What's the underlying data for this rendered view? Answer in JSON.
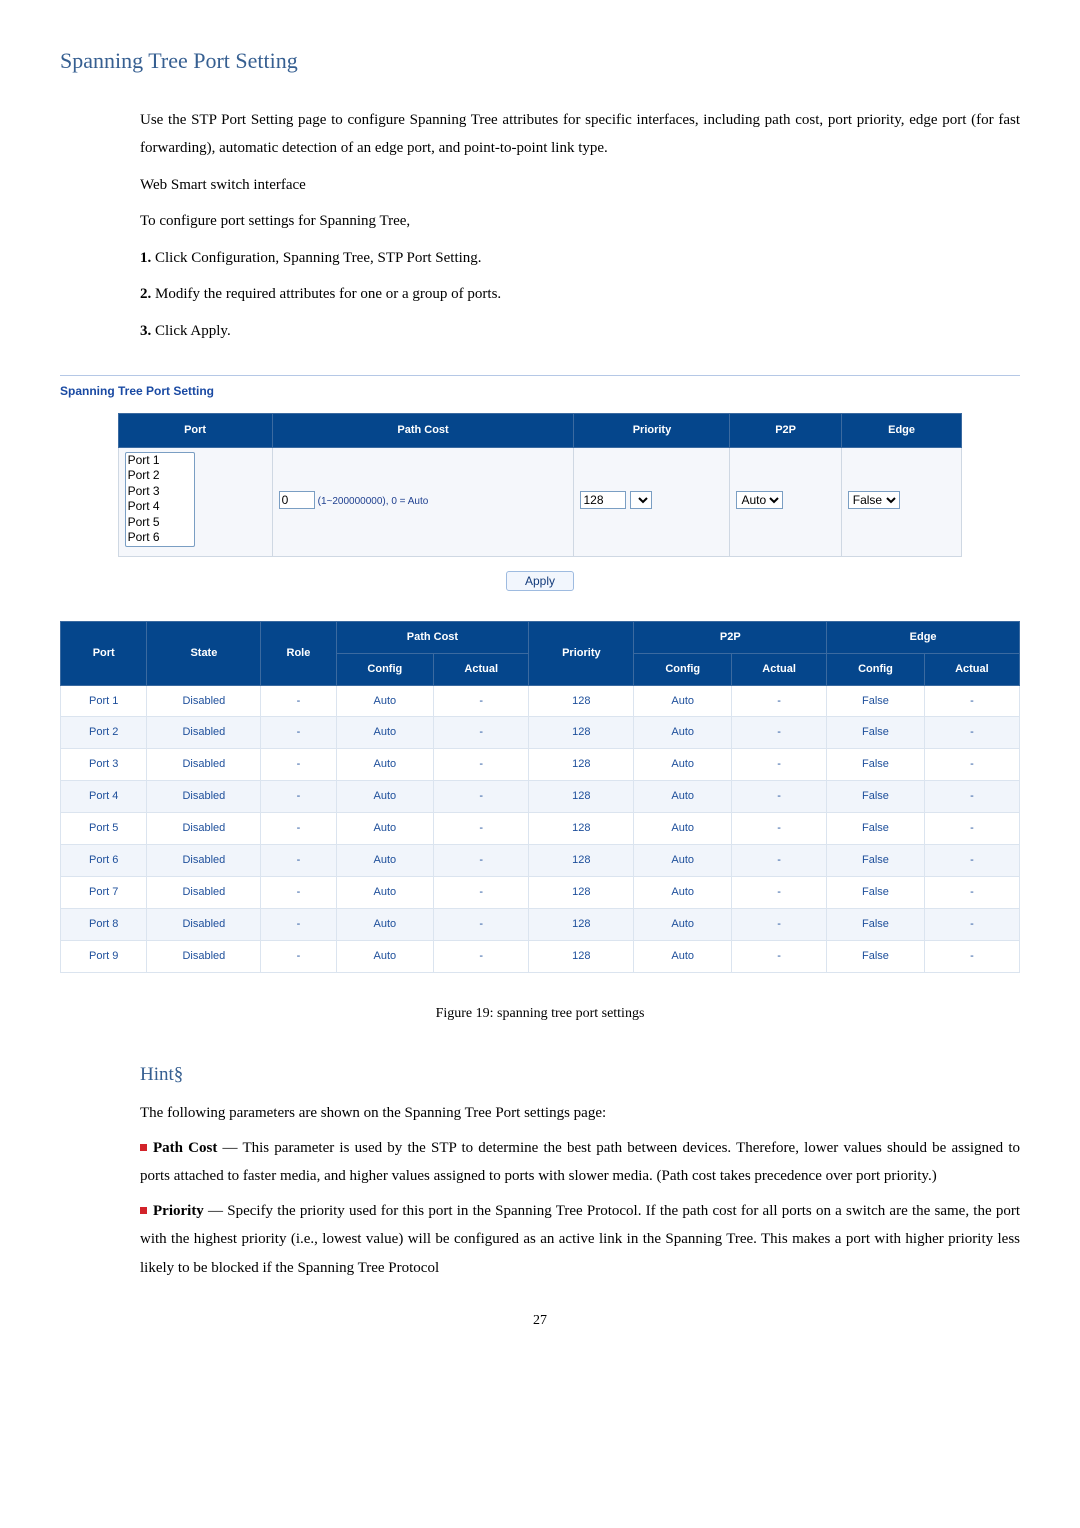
{
  "heading": "Spanning Tree Port Setting",
  "intro": "Use the STP Port Setting page to configure Spanning Tree attributes for specific interfaces, including path cost, port priority, edge port (for fast forwarding), automatic detection of an edge port, and point-to-point link type.",
  "subhead": "Web Smart switch interface",
  "configure_line": "To configure port settings for Spanning Tree,",
  "steps": [
    {
      "num": "1.",
      "text": " Click Configuration, Spanning Tree, STP Port Setting."
    },
    {
      "num": "2.",
      "text": " Modify the required attributes for one or a group of ports."
    },
    {
      "num": "3.",
      "text": " Click Apply."
    }
  ],
  "panel_title": "Spanning Tree Port Setting",
  "cfg_headers": {
    "port": "Port",
    "pathcost": "Path Cost",
    "priority": "Priority",
    "p2p": "P2P",
    "edge": "Edge"
  },
  "port_options": [
    "Port 1",
    "Port 2",
    "Port 3",
    "Port 4",
    "Port 5",
    "Port 6"
  ],
  "pathcost_value": "0",
  "pathcost_hint": "(1~200000000), 0 = Auto",
  "priority_value": "128",
  "p2p_options": [
    "Auto"
  ],
  "p2p_value": "Auto",
  "edge_options": [
    "False"
  ],
  "edge_value": "False",
  "apply_label": "Apply",
  "data_headers": {
    "port": "Port",
    "state": "State",
    "role": "Role",
    "pathcost": "Path Cost",
    "config": "Config",
    "actual": "Actual",
    "priority": "Priority",
    "p2p": "P2P",
    "edge": "Edge"
  },
  "rows": [
    {
      "port": "Port 1",
      "state": "Disabled",
      "role": "-",
      "pc_cfg": "Auto",
      "pc_act": "-",
      "priority": "128",
      "p2p_cfg": "Auto",
      "p2p_act": "-",
      "edge_cfg": "False",
      "edge_act": "-"
    },
    {
      "port": "Port 2",
      "state": "Disabled",
      "role": "-",
      "pc_cfg": "Auto",
      "pc_act": "-",
      "priority": "128",
      "p2p_cfg": "Auto",
      "p2p_act": "-",
      "edge_cfg": "False",
      "edge_act": "-"
    },
    {
      "port": "Port 3",
      "state": "Disabled",
      "role": "-",
      "pc_cfg": "Auto",
      "pc_act": "-",
      "priority": "128",
      "p2p_cfg": "Auto",
      "p2p_act": "-",
      "edge_cfg": "False",
      "edge_act": "-"
    },
    {
      "port": "Port 4",
      "state": "Disabled",
      "role": "-",
      "pc_cfg": "Auto",
      "pc_act": "-",
      "priority": "128",
      "p2p_cfg": "Auto",
      "p2p_act": "-",
      "edge_cfg": "False",
      "edge_act": "-"
    },
    {
      "port": "Port 5",
      "state": "Disabled",
      "role": "-",
      "pc_cfg": "Auto",
      "pc_act": "-",
      "priority": "128",
      "p2p_cfg": "Auto",
      "p2p_act": "-",
      "edge_cfg": "False",
      "edge_act": "-"
    },
    {
      "port": "Port 6",
      "state": "Disabled",
      "role": "-",
      "pc_cfg": "Auto",
      "pc_act": "-",
      "priority": "128",
      "p2p_cfg": "Auto",
      "p2p_act": "-",
      "edge_cfg": "False",
      "edge_act": "-"
    },
    {
      "port": "Port 7",
      "state": "Disabled",
      "role": "-",
      "pc_cfg": "Auto",
      "pc_act": "-",
      "priority": "128",
      "p2p_cfg": "Auto",
      "p2p_act": "-",
      "edge_cfg": "False",
      "edge_act": "-"
    },
    {
      "port": "Port 8",
      "state": "Disabled",
      "role": "-",
      "pc_cfg": "Auto",
      "pc_act": "-",
      "priority": "128",
      "p2p_cfg": "Auto",
      "p2p_act": "-",
      "edge_cfg": "False",
      "edge_act": "-"
    },
    {
      "port": "Port 9",
      "state": "Disabled",
      "role": "-",
      "pc_cfg": "Auto",
      "pc_act": "-",
      "priority": "128",
      "p2p_cfg": "Auto",
      "p2p_act": "-",
      "edge_cfg": "False",
      "edge_act": "-"
    }
  ],
  "figure_caption": "Figure 19: spanning tree port settings",
  "hint_heading": "Hint§",
  "hint_intro": "The following parameters are shown on the Spanning Tree Port settings page:",
  "hint_pathcost_label": "Path Cost",
  "hint_pathcost_text": " — This parameter is used by the STP to determine the best path between devices. Therefore, lower values should be assigned to ports attached to faster media, and higher values assigned to ports with slower media. (Path cost takes precedence over port priority.)",
  "hint_priority_label": "Priority",
  "hint_priority_text": " — Specify the priority used for this port in the Spanning Tree Protocol. If the path cost for all ports on a switch are the same, the port with the highest priority (i.e., lowest value) will be configured as an active link in the Spanning Tree. This makes a port with higher priority less likely to be blocked if the Spanning Tree Protocol",
  "page_number": "27"
}
